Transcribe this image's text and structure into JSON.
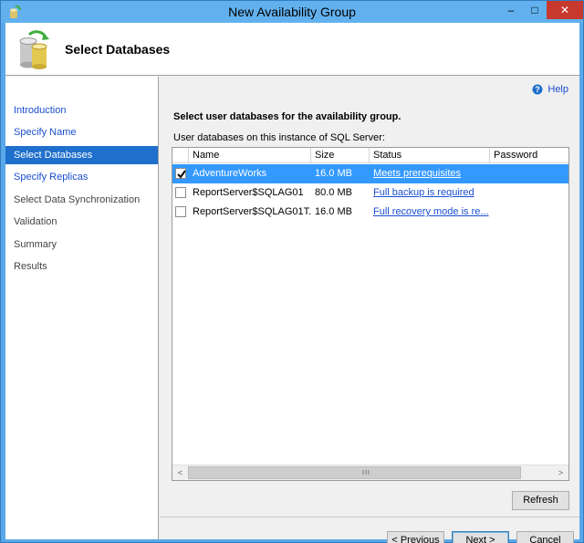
{
  "window": {
    "title": "New Availability Group",
    "controls": {
      "minimize": "–",
      "maximize": "□",
      "close": "✕"
    }
  },
  "header": {
    "title": "Select Databases"
  },
  "sidebar": {
    "items": [
      {
        "label": "Introduction",
        "state": "link"
      },
      {
        "label": "Specify Name",
        "state": "link"
      },
      {
        "label": "Select Databases",
        "state": "active"
      },
      {
        "label": "Specify Replicas",
        "state": "link"
      },
      {
        "label": "Select Data Synchronization",
        "state": "dim"
      },
      {
        "label": "Validation",
        "state": "dim"
      },
      {
        "label": "Summary",
        "state": "dim"
      },
      {
        "label": "Results",
        "state": "dim"
      }
    ]
  },
  "content": {
    "help_label": "Help",
    "section_title": "Select user databases for the availability group.",
    "subtitle": "User databases on this instance of SQL Server:",
    "table": {
      "columns": [
        "Name",
        "Size",
        "Status",
        "Password"
      ],
      "rows": [
        {
          "checked": true,
          "name": "AdventureWorks",
          "size": "16.0 MB",
          "status": "Meets prerequisites",
          "password": ""
        },
        {
          "checked": false,
          "name": "ReportServer$SQLAG01",
          "size": "80.0 MB",
          "status": "Full backup is required",
          "password": ""
        },
        {
          "checked": false,
          "name": "ReportServer$SQLAG01T...",
          "size": "16.0 MB",
          "status": "Full recovery mode is re...",
          "password": ""
        }
      ]
    },
    "scrollbar": {
      "left": "<",
      "right": ">",
      "grip": "III"
    },
    "refresh_label": "Refresh"
  },
  "footer": {
    "previous_label": "< Previous",
    "next_label": "Next >",
    "cancel_label": "Cancel"
  },
  "colors": {
    "accent": "#1f6fcc",
    "selection": "#3399ff",
    "link": "#1a4fd0",
    "close": "#c7392f"
  }
}
